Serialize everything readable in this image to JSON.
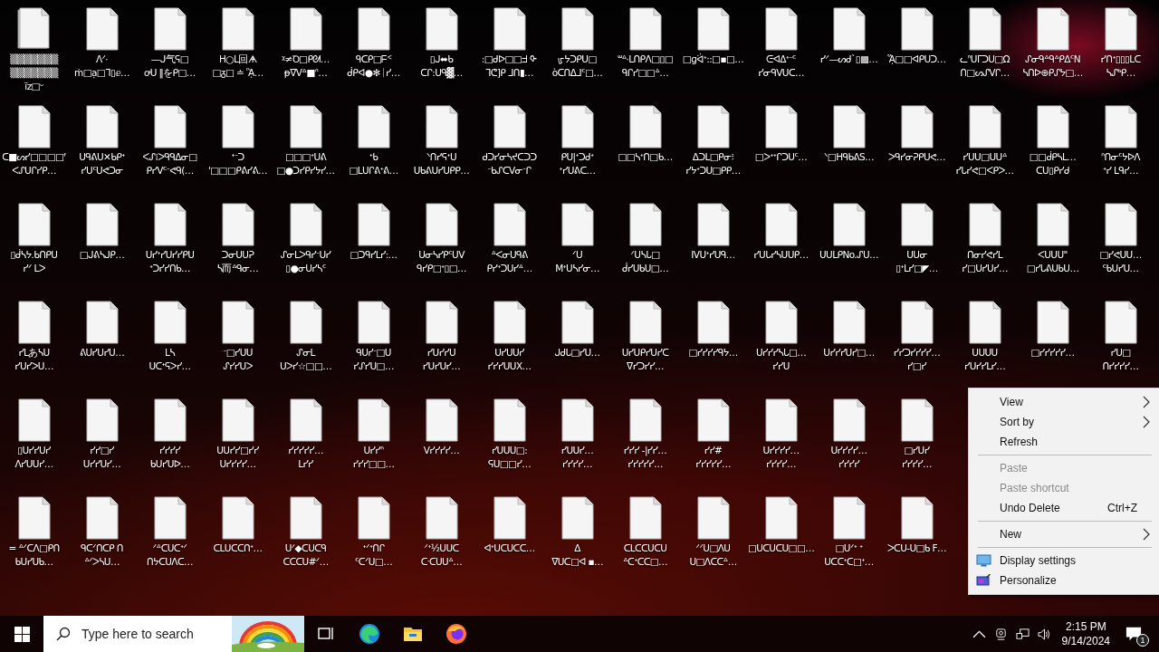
{
  "desktop": {
    "rows": [
      [
        {
          "label": "▒▒▒▒▒▒▒\n▒▒▒▒▒▒▒\nïz□ᵕ",
          "kind": "stack"
        },
        {
          "label": "ᐱᐟ·\nṁ□ạ□ᒣ▯ⅇ…",
          "kind": "file"
        },
        {
          "label": "—ᒍ气ᕋ□\nꝍᑌ ‖をᑭ□…",
          "kind": "file"
        },
        {
          "label": "ᕼ○ᒪ回ᗗ\n□ᵹ□ ≐ ᾋ…",
          "kind": "file"
        },
        {
          "label": "ᵡ≠Ꝺ□ᑭᘛ…\nᵽᐁᐯᐞ■ᐢ…",
          "kind": "file"
        },
        {
          "label": "ᑫᑕᑭ□ᖴᑉ\nᑰᑭᐊ●✻ᛁᓯ…",
          "kind": "file"
        },
        {
          "label": "▯ᒍ⬌ᑲ\nᑕᒋ:ᑌᑫ▓…",
          "kind": "file"
        },
        {
          "label": ":□ᑯᐅ□□ᖵ ᡐ\nᒣᕦ]ᑭ ᒧᑎ▮…",
          "kind": "file"
        },
        {
          "label": "ᡁᔭᑐᑭᑌ□\nὸᑕᑎᐃᒧᑦ□…",
          "kind": "file"
        },
        {
          "label": "ᐜᐞ·ᒪᑎᑭᐱ□▯□\nᑫᒋᓯ□□ᐞ…",
          "kind": "file"
        },
        {
          "label": "□ɡᐛᕀ::□▪□…",
          "kind": "file"
        },
        {
          "label": "ᕮᐊᐃᐩᐨᑦ\nᓯᓂᑫᐯᑌᑕ…",
          "kind": "file"
        },
        {
          "label": "ᓯᐟ—ᔕᑯ`▯▩…",
          "kind": "file"
        },
        {
          "label": "ᾍ□□ᐊᑭᑌᑐ…",
          "kind": "file"
        },
        {
          "label": "ᓚᐢᑌᒥᑐᑌ□Ω\nᑎ□ᔕᔑᐯᒋ…",
          "kind": "file"
        },
        {
          "label": "ᔑᓂᑫᐞᑫᐞᑭᐃᑦN\nᓴᑎᐅ⊕ᑭᔑᔭ□…",
          "kind": "file"
        },
        {
          "label": "ᓯᑎᐩ▯▯▯ᒪᑕ\nᓴᔑᒃᑭ…",
          "kind": "file"
        }
      ],
      [
        {
          "label": "ᑕ■ᔕᓯ□□□□ᶠ\nᐸᔑᑌᒋᓯᑭ…",
          "kind": "file"
        },
        {
          "label": "ᑌᑫᕕᑌ✕ᑲᑭᐩ\nᓯᑌᑦᑌᕙᑐᓂ",
          "kind": "file"
        },
        {
          "label": "ᐸᔑ⁞ᐳᑫᑫᐃᓂ□\nᑭᓯᐯᑦᐨᕙᑫ(…",
          "kind": "file"
        },
        {
          "label": "ᐩᐨᑐ\n'□□□ᑭᕕᓯᕕ…",
          "kind": "file"
        },
        {
          "label": "□□□ᐩᑌᕕ\n□●ᑐᓯᑭᓯᔭᓯ…",
          "kind": "file"
        },
        {
          "label": "ᐩᑲ\n□ᒪᑌᒋᕕᐩᕕ…",
          "kind": "file"
        },
        {
          "label": "ᐠᑎᓯᕋᐩᑌ\nᑌᑲᕕᑌᓯᑌᑭᑭ…",
          "kind": "file"
        },
        {
          "label": "ᑯᑐᓯᓂᓴᔪᑕᑐᑐ\nᐨᑲᔑᑕᐯᓂᐨᒋ",
          "kind": "file"
        },
        {
          "label": "ᑭᑌ|ᐩᑐᑯᐩ\nᐩᓯᑌᕕᑕ…",
          "kind": "file"
        },
        {
          "label": "□□ᓴᐩᑎ□ᑲ…",
          "kind": "file"
        },
        {
          "label": "ᐃᑐᒪ□ᑭᓂ⁝\nᓯᔭᐩᑐᑌ□ᑭᑭ…",
          "kind": "file"
        },
        {
          "label": "□ᐳᐩᐩᒋᑐᑌᑦ…",
          "kind": "file"
        },
        {
          "label": "ᐠ□ᕼᑫᑲᕕS…",
          "kind": "file"
        },
        {
          "label": "ᐳᑫᓯᓂᕈᑭᑌᕙ…",
          "kind": "file"
        },
        {
          "label": "ᓯᑌᑌ□ᑌᑌᐞ\nᓯᒐᓯᕙ□ᐸᑭᐳ…",
          "kind": "file"
        },
        {
          "label": "□□ᑰᑭᓴᒪ…\nᑕᑌ▯ᑭᓯᑯ",
          "kind": "file"
        },
        {
          "label": "ᐢᑎᓂᑦᔭᐅᐱ\nᐩᓯ ᒪᑫᓯ…",
          "kind": "file"
        }
      ],
      [
        {
          "label": "▯ᑰᓴᔭ.ᑲᑎᑭᑌ\nᓯᐟ ᒪᐳ",
          "kind": "file"
        },
        {
          "label": "□ᒍᕕᓴᒍᑭ…",
          "kind": "file"
        },
        {
          "label": "ᑌᓯᐩᓯᑌᓯᓯᑭᑌ\nᐩᑐᓯᓯᑎᑲ…",
          "kind": "file"
        },
        {
          "label": "ᑐᓂᑌᑌᕈ\nᓴ而ᐞᑫᓂ…",
          "kind": "file"
        },
        {
          "label": "ᔑᓂᒪᐳᑫᓯᐨᑌᓯ\n▯●ᓂᑌᓯᓴᑦ",
          "kind": "file"
        },
        {
          "label": "□ᑐᑫᓯᒪᓯ:…",
          "kind": "file"
        },
        {
          "label": "ᑌᓂᓴᓯᑭᑦᑌᐯ\nᑫᓯᑭ□ᐩ▯□…",
          "kind": "file"
        },
        {
          "label": "ᐞᐸᓂᑌᑫᕕ\nᑭᓯᐩᑐᑌᓯᐞ…",
          "kind": "file"
        },
        {
          "label": "ᐟᑌ\nMᐩᑌᓴᓯᓂ…",
          "kind": "file"
        },
        {
          "label": "ᐟᑌᓴᒐ□\nᑰᓯᑌᑲᑌ□…",
          "kind": "file"
        },
        {
          "label": "IVᑌᐩᓯᑌᑫ…",
          "kind": "file"
        },
        {
          "label": "ᓯᑌᒐᓯᓴᑌᑌᑭ…",
          "kind": "file"
        },
        {
          "label": "ᑌᑌᒪᑭNo.ᔑᑌ…",
          "kind": "file"
        },
        {
          "label": "ᑌᑌᓂ\n▯ᐩᒪᓯ□◤…",
          "kind": "file"
        },
        {
          "label": "ᑎᓂᓯᕙᓯᒪ\nᓯ□ᑌᓯᑌᓯ…",
          "kind": "file"
        },
        {
          "label": "ᐸᑌᑌᑌ\"\n□ᓯᒐᕕᑌᑲᑌ…",
          "kind": "file"
        },
        {
          "label": "□ᓯᕙᑌᑌ…\nᑦᑲᑌᓯᑌ…",
          "kind": "file"
        }
      ],
      [
        {
          "label": "ᓯᒪあᓴᑌ\nᓯᑌᓯᐳᑌ…",
          "kind": "file"
        },
        {
          "label": "ᕕᑌᓯᑌᓯᑌ…",
          "kind": "file"
        },
        {
          "label": "ᒪᓴ\nᑌᑕᐩᕋᐳᓯ…",
          "kind": "file"
        },
        {
          "label": "ᐨ□ᓯᑌᑌ\nᔑᓯᓯᑌᐳ",
          "kind": "file"
        },
        {
          "label": "ᔑᓂᒪ\nᑌᐳᓯ☆□□…",
          "kind": "file"
        },
        {
          "label": "ᑫᑌᓯᐨ□ᑌ\nᓯᔑᓯᑌ□…",
          "kind": "file"
        },
        {
          "label": "ᓯᑌᓯᓯᑌ\nᓯᑌᓯᑌᓯ…",
          "kind": "file"
        },
        {
          "label": "ᑌᓯᑌᑌᓯ\nᓯᓯᓯᑌᑌX…",
          "kind": "file"
        },
        {
          "label": "ᒍᑯᒐ□ᓯᑌ…",
          "kind": "file"
        },
        {
          "label": "ᑌᓯᑌᑭᓯᑌᓯᑕ\nᐁᓯᑐᓯᓯ…",
          "kind": "file"
        },
        {
          "label": "□ᓯᓯᓯᓯᑫᔭ…",
          "kind": "file"
        },
        {
          "label": "ᑌᓯᓯᓯᓴᒐ□…\nᓯᓯᑌ",
          "kind": "file"
        },
        {
          "label": "ᑌᓯᓯᓯᑌᓯ□…",
          "kind": "file"
        },
        {
          "label": "ᓯᓯᑐᓯᓯᓯᓯ…\nᓯ□ᓯ",
          "kind": "file"
        },
        {
          "label": "ᑌᑌᑌᑌ\nᓯᑌᓯᓯᒪᓯ…",
          "kind": "file"
        },
        {
          "label": "□ᓯᓯᓯᓯᓯ…",
          "kind": "file"
        },
        {
          "label": "ᓯᑌ□\nᑎᓯᓯᓯᓯ…",
          "kind": "file"
        }
      ],
      [
        {
          "label": "▯ᑌᓯᓯᑌᓯ\nᐱᓯᑌᑌᓯ…",
          "kind": "file"
        },
        {
          "label": "ᓯᓯ□ᓯ\nᑌᓯᓯᑌᓯ…",
          "kind": "file"
        },
        {
          "label": "ᓯᓯᓯᓯ\nᑲᑌᓯᑌᐅ…",
          "kind": "file"
        },
        {
          "label": "ᑌᑌᓯᓯ□ᓯᓯ\nᑌᓯᓯᓯᓯ…",
          "kind": "file"
        },
        {
          "label": "ᓯᓯᓯᓯᓯ…\nᒪᓯᓯ",
          "kind": "file"
        },
        {
          "label": "ᑌᓯᓯᐢ\nᓯᓯᓯ□□…",
          "kind": "file"
        },
        {
          "label": "ᐯᓯᓯᓯᓯ…",
          "kind": "file"
        },
        {
          "label": "ᓯᑌᑌᑌ□:\nᕋᑌ□□ᓯ…",
          "kind": "file"
        },
        {
          "label": "ᓯᑌᑌᓯ…\nᓯᓯᓯᓯ…",
          "kind": "file"
        },
        {
          "label": "ᓯᓯᓯ -|ᓯᓯ…\nᓯᓯᓯᓯᓯ…",
          "kind": "file"
        },
        {
          "label": "ᓯᓯ#\nᓯᓯᓯᓯᓯ…",
          "kind": "file"
        },
        {
          "label": "ᑌᓯᓯᓯᓯ…\nᓯᓯᓯᓯ…",
          "kind": "file"
        },
        {
          "label": "ᑌᓯᓯᓯᓯ…\nᓯᓯᓯᓯ",
          "kind": "file"
        },
        {
          "label": "□ᓯᑌᓯ\nᓯᓯᓯᓯ…",
          "kind": "file"
        }
      ],
      [
        {
          "label": "= ᐞᐟᑕᐱ□ᑭᑎ\nᑲᑌᓯᑌᑲ…",
          "kind": "file"
        },
        {
          "label": "ᑫᑕᐟᑎᑕᑭ ᑎ\nᐞᐟᐳᓴᑌ…",
          "kind": "file"
        },
        {
          "label": "ᐟᐞᑕᑌᑕᐩᐟ\nᑎᔭᑕᑌᐱᑕ…",
          "kind": "file"
        },
        {
          "label": "ᑕᒪᑌᑕᑕᑎᐩ…",
          "kind": "file"
        },
        {
          "label": "ᑌᐟ◆ᑕᑌᑕᑫ\nᑕᑕᑕᑌ#ᐟ…",
          "kind": "file"
        },
        {
          "label": "ᐩᐟᐩᑎᒋ\nᑦᑕᐟᑌ□…",
          "kind": "file"
        },
        {
          "label": "ᐟᐩ½ᑌᑌᑕ\nᑕᐧᑕᑌᑌᐞ…",
          "kind": "file"
        },
        {
          "label": "ᐊᐩᑌᑕᑌᑕᑕ…",
          "kind": "file"
        },
        {
          "label": "ᐃ\nᐁᑌᑕ□ᐊ ▪…",
          "kind": "file"
        },
        {
          "label": "ᑕᒪᑕᑕᑌᑕᑌ\nᐞᑕᐩᑕᑕ□…",
          "kind": "file"
        },
        {
          "label": "ᐟᐟᑌ□ᐱᑌ\nᑌ□ᐱᑕᑕᐞ…",
          "kind": "file"
        },
        {
          "label": "□ᑌᑕᑌᑕᑌ□□…",
          "kind": "file"
        },
        {
          "label": "□ᑌᐟᐩ ᐩ\nᑌᑕᑕᐩᑕ□ᐩ…",
          "kind": "file"
        },
        {
          "label": "ᐳᑕᑌ-ᑌ□ᑲ F…",
          "kind": "file"
        }
      ]
    ]
  },
  "context_menu": {
    "items": [
      {
        "kind": "item",
        "label": "View",
        "submenu": true,
        "disabled": false
      },
      {
        "kind": "item",
        "label": "Sort by",
        "submenu": true,
        "disabled": false
      },
      {
        "kind": "item",
        "label": "Refresh",
        "submenu": false,
        "disabled": false
      },
      {
        "kind": "separator"
      },
      {
        "kind": "item",
        "label": "Paste",
        "submenu": false,
        "disabled": true
      },
      {
        "kind": "item",
        "label": "Paste shortcut",
        "submenu": false,
        "disabled": true
      },
      {
        "kind": "item",
        "label": "Undo Delete",
        "shortcut": "Ctrl+Z",
        "submenu": false,
        "disabled": false
      },
      {
        "kind": "separator"
      },
      {
        "kind": "item",
        "label": "New",
        "submenu": true,
        "disabled": false
      },
      {
        "kind": "separator"
      },
      {
        "kind": "display",
        "label": "Display settings",
        "submenu": false,
        "disabled": false
      },
      {
        "kind": "personalize",
        "label": "Personalize",
        "submenu": false,
        "disabled": false
      }
    ]
  },
  "taskbar": {
    "search": {
      "placeholder": "Type here to search"
    },
    "apps": [
      {
        "kind": "taskview"
      },
      {
        "kind": "edge"
      },
      {
        "kind": "explorer"
      },
      {
        "kind": "firefox"
      }
    ],
    "clock": {
      "time": "2:15 PM",
      "date": "9/14/2024"
    },
    "notifications": {
      "count": "1"
    }
  }
}
